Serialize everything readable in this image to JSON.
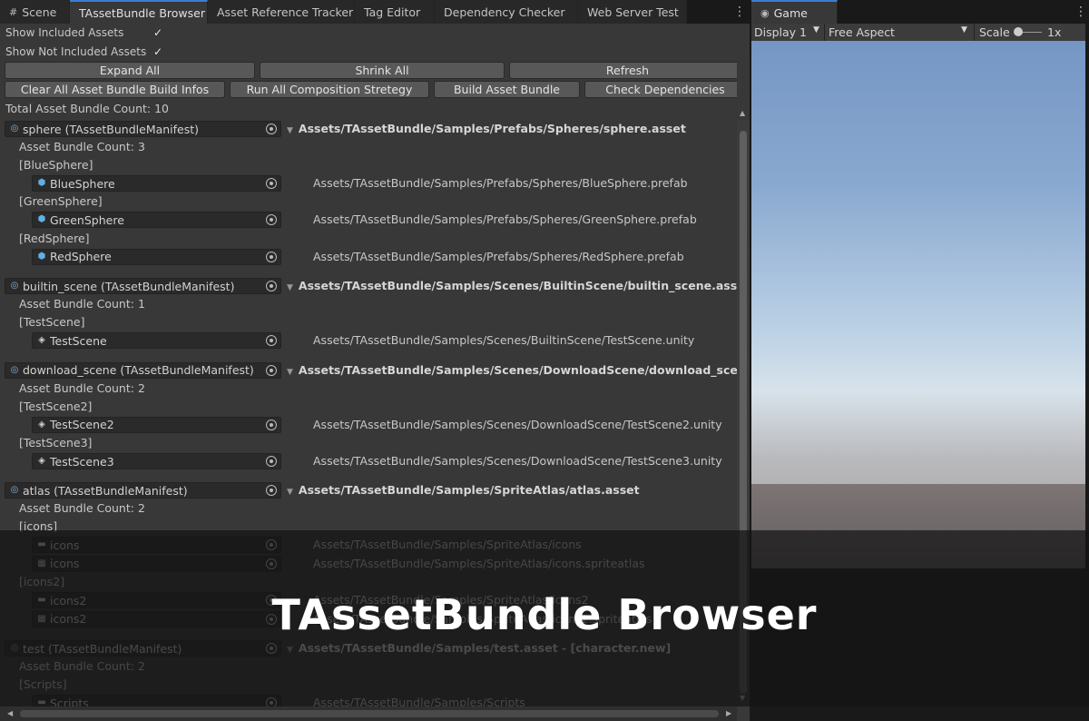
{
  "tabs": {
    "left": [
      {
        "label": "Scene",
        "icon": "grid-icon"
      },
      {
        "label": "TAssetBundle Browser",
        "active": true
      },
      {
        "label": "Asset Reference Tracker"
      },
      {
        "label": "Tag Editor"
      },
      {
        "label": "Dependency Checker"
      },
      {
        "label": "Web Server Test"
      }
    ],
    "right": {
      "label": "Game",
      "icon": "gamepad-icon"
    },
    "kebab": "⋮"
  },
  "options": {
    "show_included": {
      "label": "Show Included Assets",
      "checked": true
    },
    "show_not_included": {
      "label": "Show Not Included Assets",
      "checked": true
    },
    "check_glyph": "✓"
  },
  "buttons": {
    "expand_all": "Expand All",
    "shrink_all": "Shrink All",
    "refresh": "Refresh",
    "clear_infos": "Clear All Asset Bundle Build Infos",
    "run_composition": "Run All Composition Stretegy",
    "build_bundle": "Build Asset Bundle",
    "check_deps": "Check Dependencies"
  },
  "total_count": "Total Asset Bundle Count: 10",
  "manifests": [
    {
      "name": "sphere (TAssetBundleManifest)",
      "path": "Assets/TAssetBundle/Samples/Prefabs/Spheres/sphere.asset",
      "count": "Asset Bundle Count: 3",
      "groups": [
        {
          "tag": "[BlueSphere]",
          "assets": [
            {
              "name": "BlueSphere",
              "icon": "prefab-icon",
              "path": "Assets/TAssetBundle/Samples/Prefabs/Spheres/BlueSphere.prefab"
            }
          ]
        },
        {
          "tag": "[GreenSphere]",
          "assets": [
            {
              "name": "GreenSphere",
              "icon": "prefab-icon",
              "path": "Assets/TAssetBundle/Samples/Prefabs/Spheres/GreenSphere.prefab"
            }
          ]
        },
        {
          "tag": "[RedSphere]",
          "assets": [
            {
              "name": "RedSphere",
              "icon": "prefab-icon",
              "path": "Assets/TAssetBundle/Samples/Prefabs/Spheres/RedSphere.prefab"
            }
          ]
        }
      ]
    },
    {
      "name": "builtin_scene (TAssetBundleManifest)",
      "path": "Assets/TAssetBundle/Samples/Scenes/BuiltinScene/builtin_scene.asset",
      "count": "Asset Bundle Count: 1",
      "groups": [
        {
          "tag": "[TestScene]",
          "assets": [
            {
              "name": "TestScene",
              "icon": "scene-icon",
              "path": "Assets/TAssetBundle/Samples/Scenes/BuiltinScene/TestScene.unity"
            }
          ]
        }
      ]
    },
    {
      "name": "download_scene (TAssetBundleManifest)",
      "path": "Assets/TAssetBundle/Samples/Scenes/DownloadScene/download_scene.asset",
      "count": "Asset Bundle Count: 2",
      "groups": [
        {
          "tag": "[TestScene2]",
          "assets": [
            {
              "name": "TestScene2",
              "icon": "scene-icon",
              "path": "Assets/TAssetBundle/Samples/Scenes/DownloadScene/TestScene2.unity"
            }
          ]
        },
        {
          "tag": "[TestScene3]",
          "assets": [
            {
              "name": "TestScene3",
              "icon": "scene-icon",
              "path": "Assets/TAssetBundle/Samples/Scenes/DownloadScene/TestScene3.unity"
            }
          ]
        }
      ]
    },
    {
      "name": "atlas (TAssetBundleManifest)",
      "path": "Assets/TAssetBundle/Samples/SpriteAtlas/atlas.asset",
      "count": "Asset Bundle Count: 2",
      "groups": [
        {
          "tag": "[icons]",
          "assets": [
            {
              "name": "icons",
              "icon": "folder-icon",
              "path": "Assets/TAssetBundle/Samples/SpriteAtlas/icons"
            },
            {
              "name": "icons",
              "icon": "spriteatlas-icon",
              "path": "Assets/TAssetBundle/Samples/SpriteAtlas/icons.spriteatlas"
            }
          ]
        },
        {
          "tag": "[icons2]",
          "assets": [
            {
              "name": "icons2",
              "icon": "folder-icon",
              "path": "Assets/TAssetBundle/Samples/SpriteAtlas/icons2"
            },
            {
              "name": "icons2",
              "icon": "spriteatlas-icon",
              "path": "Assets/TAssetBundle/Samples/SpriteAtlas/icons2.spriteatlas"
            }
          ]
        }
      ]
    },
    {
      "name": "test (TAssetBundleManifest)",
      "path": "Assets/TAssetBundle/Samples/test.asset - [character.new]",
      "count": "Asset Bundle Count: 2",
      "groups": [
        {
          "tag": "[Scripts]",
          "assets": [
            {
              "name": "Scripts",
              "icon": "folder-icon",
              "path": "Assets/TAssetBundle/Samples/Scripts"
            }
          ]
        }
      ]
    }
  ],
  "game_toolbar": {
    "display": "Display 1",
    "aspect": "Free Aspect",
    "scale_label": "Scale",
    "scale_value": "1x"
  },
  "overlay_title": "TAssetBundle Browser"
}
